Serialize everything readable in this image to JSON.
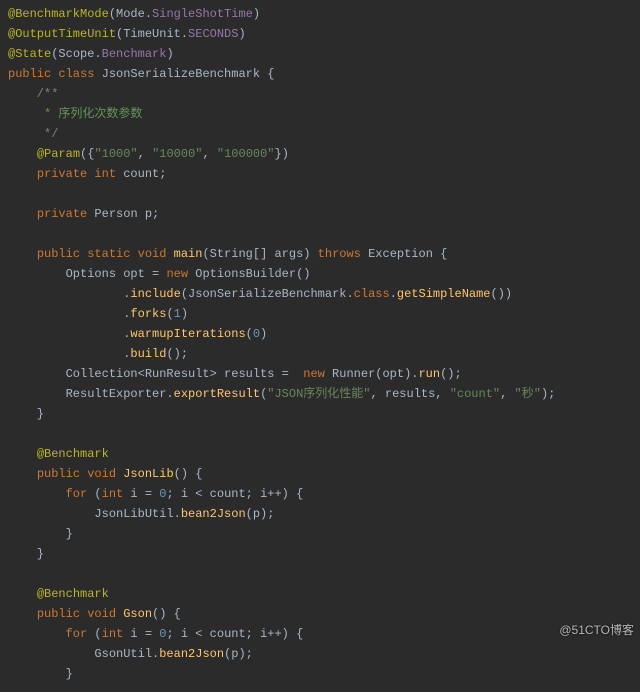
{
  "watermark": "@51CTO博客",
  "code": {
    "l01_ann": "@BenchmarkMode",
    "l01_p1": "(Mode.",
    "l01_fld": "SingleShotTime",
    "l01_p2": ")",
    "l02_ann": "@OutputTimeUnit",
    "l02_p1": "(TimeUnit.",
    "l02_fld": "SECONDS",
    "l02_p2": ")",
    "l03_ann": "@State",
    "l03_p1": "(Scope.",
    "l03_fld": "Benchmark",
    "l03_p2": ")",
    "l04_kw1": "public class",
    "l04_typ": " JsonSerializeBenchmark {",
    "l05": "    /**",
    "l06": "     * 序列化次数参数",
    "l07": "     */",
    "l08_ann": "@Param",
    "l08_p1": "({",
    "l08_s1": "\"1000\"",
    "l08_c1": ", ",
    "l08_s2": "\"10000\"",
    "l08_c2": ", ",
    "l08_s3": "\"100000\"",
    "l08_p2": "})",
    "l09_kw": "private int",
    "l09_rest": " count;",
    "l10_kw": "private",
    "l10_rest": " Person p;",
    "l11_kw1": "public static void",
    "l11_mtd": " main",
    "l11_p1": "(String[] args) ",
    "l11_kw2": "throws",
    "l11_p2": " Exception {",
    "l12_p1": "        Options opt = ",
    "l12_kw": "new",
    "l12_p2": " OptionsBuilder()",
    "l13_p1": "                .",
    "l13_mtd": "include",
    "l13_p2": "(JsonSerializeBenchmark.",
    "l13_kw": "class",
    "l13_p3": ".",
    "l13_mtd2": "getSimpleName",
    "l13_p4": "())",
    "l14_p1": "                .",
    "l14_mtd": "forks",
    "l14_p2": "(",
    "l14_num": "1",
    "l14_p3": ")",
    "l15_p1": "                .",
    "l15_mtd": "warmupIterations",
    "l15_p2": "(",
    "l15_num": "0",
    "l15_p3": ")",
    "l16_p1": "                .",
    "l16_mtd": "build",
    "l16_p2": "();",
    "l17_p1": "        Collection<RunResult> results =  ",
    "l17_kw": "new",
    "l17_p2": " Runner(opt).",
    "l17_mtd": "run",
    "l17_p3": "();",
    "l18_p1": "        ResultExporter.",
    "l18_mtd": "exportResult",
    "l18_p2": "(",
    "l18_s1": "\"JSON序列化性能\"",
    "l18_c1": ", results, ",
    "l18_s2": "\"count\"",
    "l18_c2": ", ",
    "l18_s3": "\"秒\"",
    "l18_p3": ");",
    "l19": "    }",
    "l20_ann": "@Benchmark",
    "l21_kw": "public void",
    "l21_mtd": " JsonLib",
    "l21_p": "() {",
    "l22_kw1": "for",
    "l22_p1": " (",
    "l22_kw2": "int",
    "l22_p2": " i = ",
    "l22_n1": "0",
    "l22_p3": "; i < count; i++) {",
    "l23_p1": "            JsonLibUtil.",
    "l23_mtd": "bean2Json",
    "l23_p2": "(p);",
    "l24": "        }",
    "l25": "    }",
    "l26_ann": "@Benchmark",
    "l27_kw": "public void",
    "l27_mtd": " Gson",
    "l27_p": "() {",
    "l28_kw1": "for",
    "l28_p1": " (",
    "l28_kw2": "int",
    "l28_p2": " i = ",
    "l28_n1": "0",
    "l28_p3": "; i < count; i++) {",
    "l29_p1": "            GsonUtil.",
    "l29_mtd": "bean2Json",
    "l29_p2": "(p);",
    "l30": "        }"
  }
}
